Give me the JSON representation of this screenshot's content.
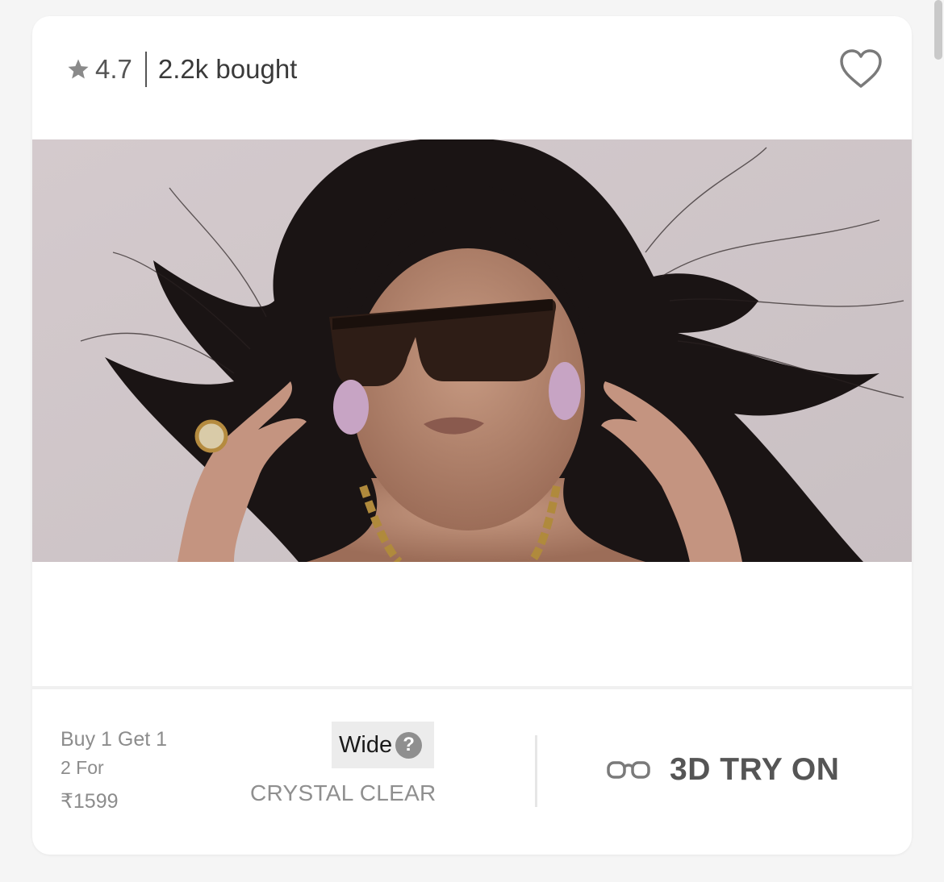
{
  "header": {
    "star_icon": "star-icon",
    "rating": "4.7",
    "bought": "2.2k bought",
    "wishlist_icon": "heart-outline-icon"
  },
  "product": {
    "image_description": "model-wearing-black-square-sunglasses"
  },
  "offer": {
    "line1": "Buy 1 Get 1",
    "line2": "2 For",
    "price": "₹1599"
  },
  "fit": {
    "label": "Wide",
    "help_symbol": "?"
  },
  "lens": "CRYSTAL CLEAR",
  "try_on": {
    "icon": "glasses-icon",
    "label": "3D TRY ON"
  }
}
